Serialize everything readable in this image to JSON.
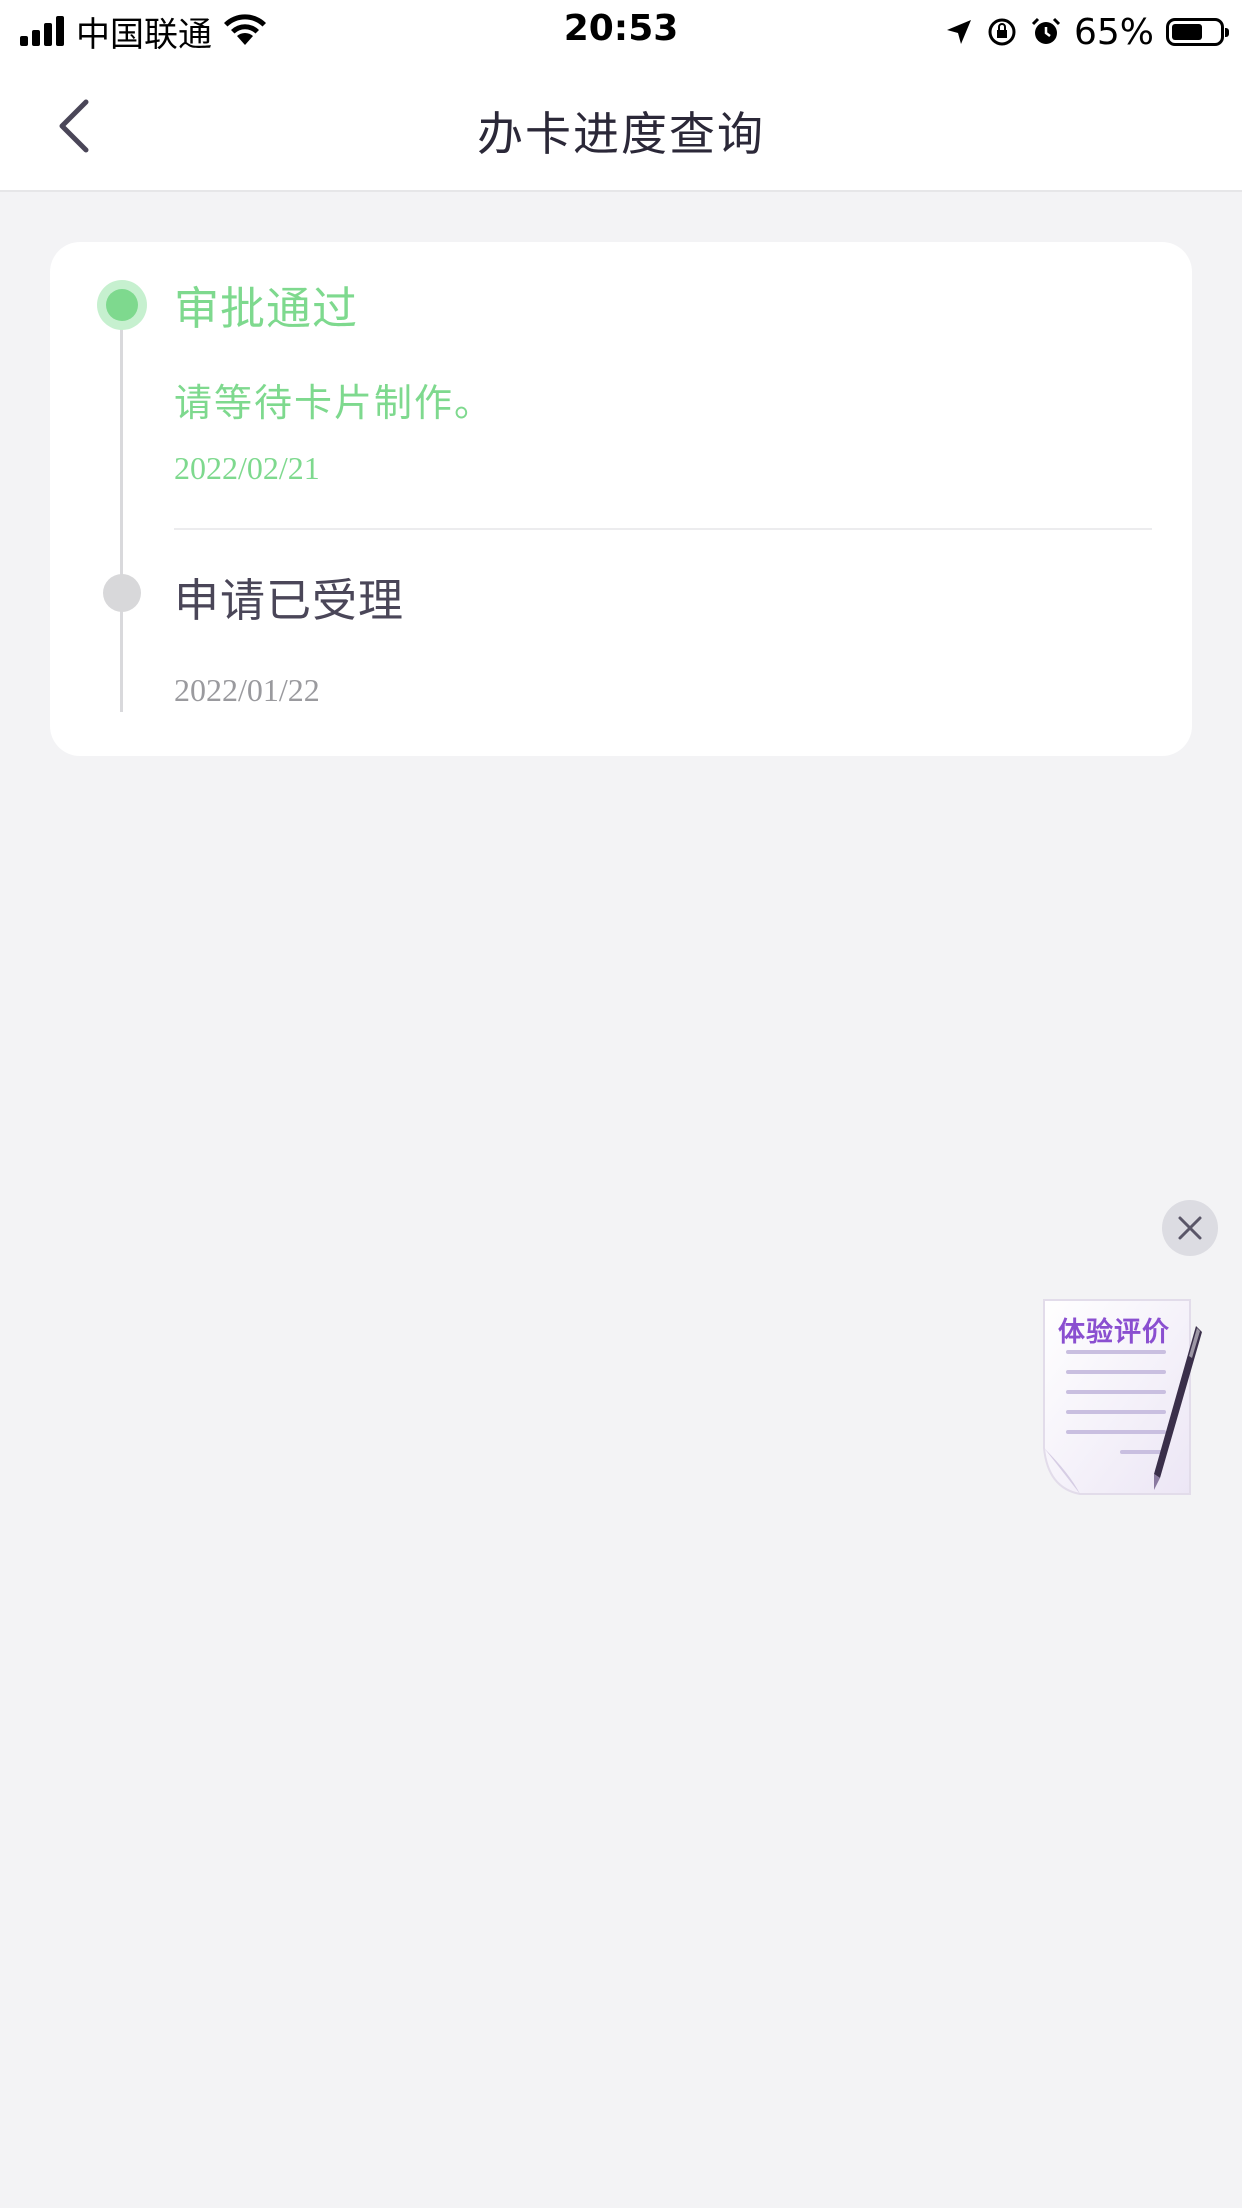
{
  "status_bar": {
    "carrier": "中国联通",
    "time": "20:53",
    "battery_percent_text": "65%",
    "battery_level": 0.65,
    "icons": [
      "signal-icon",
      "wifi-icon",
      "location-icon",
      "rotation-lock-icon",
      "alarm-icon",
      "battery-icon"
    ]
  },
  "nav": {
    "back_icon": "chevron-left-icon",
    "title": "办卡进度查询"
  },
  "timeline": {
    "steps": [
      {
        "title": "审批通过",
        "description": "请等待卡片制作。",
        "date": "2022/02/21",
        "state": "active"
      },
      {
        "title": "申请已受理",
        "date": "2022/01/22",
        "state": "done"
      }
    ]
  },
  "floating": {
    "close_icon": "close-icon",
    "feedback_label": "体验评价",
    "feedback_icon": "document-pen-icon"
  },
  "colors": {
    "active_green": "#7ed98e",
    "inactive_grey": "#d8d8da",
    "background": "#f3f3f5",
    "feedback_purple": "#8a4fd0"
  }
}
